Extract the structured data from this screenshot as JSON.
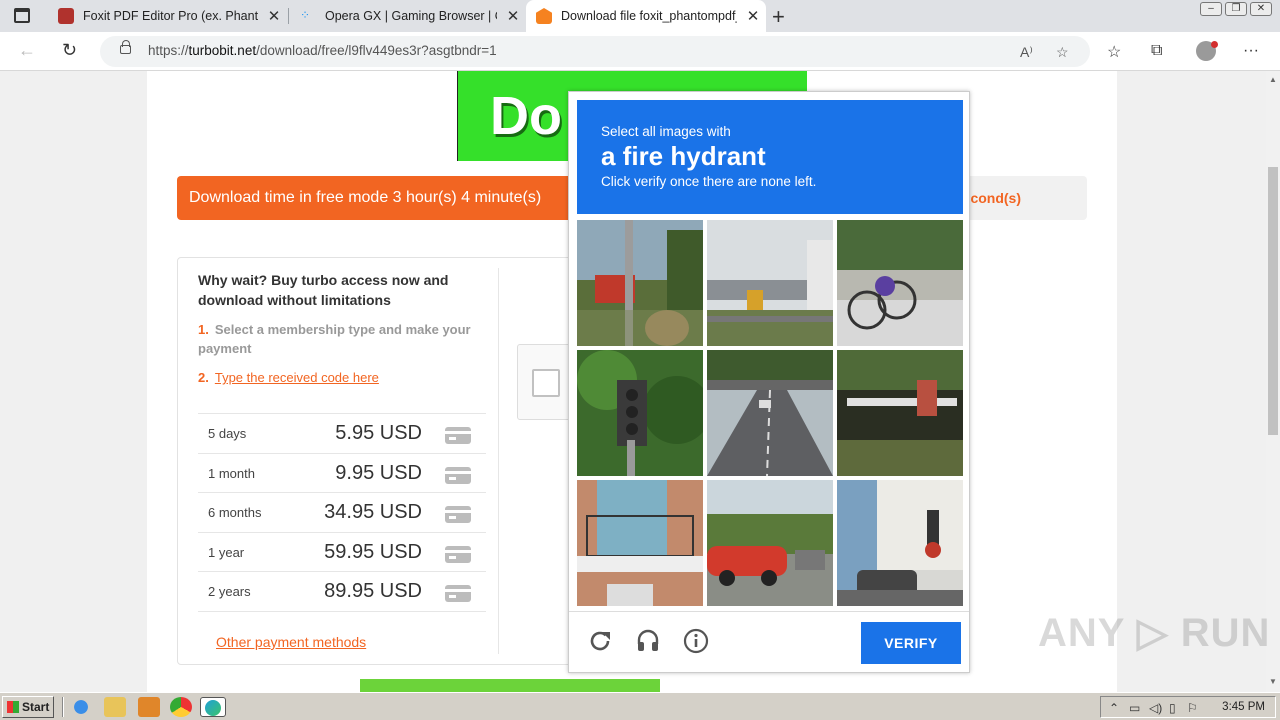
{
  "browser": {
    "tabs": [
      {
        "title": "Foxit PDF Editor Pro (ex. Phantom",
        "favicon_color": "#b0322d",
        "active": false
      },
      {
        "title": "Opera GX | Gaming Browser | Op",
        "favicon_color": "#2196f3",
        "active": false
      },
      {
        "title": "Download file foxit_phantompdf_",
        "favicon_color": "#f58220",
        "active": true
      }
    ],
    "new_tab_label": "+",
    "url_prefix": "https://",
    "url_domain": "turbobit.net",
    "url_path": "/download/free/l9flv449es3r?asgtbndr=1"
  },
  "page": {
    "banner_text": "Do",
    "timer_text": "Download time in free mode 3 hour(s) 4 minute(s)",
    "timer_right": "cond(s)",
    "turbo": {
      "heading": "Why wait? Buy turbo access now and download without limitations",
      "step1_num": "1.",
      "step1": "Select a membership type and make your payment",
      "step2_num": "2.",
      "step2": "Type the received code here",
      "plans": [
        {
          "period": "5 days",
          "price": "5.95 USD"
        },
        {
          "period": "1 month",
          "price": "9.95 USD"
        },
        {
          "period": "6 months",
          "price": "34.95 USD"
        },
        {
          "period": "1 year",
          "price": "59.95 USD"
        },
        {
          "period": "2 years",
          "price": "89.95 USD"
        }
      ],
      "other_payment": "Other payment methods"
    }
  },
  "captcha": {
    "instruction_line1": "Select all images with",
    "target": "a fire hydrant",
    "instruction_line3": "Click verify once there are none left.",
    "verify_label": "VERIFY",
    "header_color": "#1a73e8",
    "tiles": [
      {
        "name": "street-traffic-light-tile"
      },
      {
        "name": "building-bridge-tile"
      },
      {
        "name": "bicycles-tile"
      },
      {
        "name": "traffic-light-tile"
      },
      {
        "name": "highway-tile"
      },
      {
        "name": "park-bench-tile"
      },
      {
        "name": "balcony-tile"
      },
      {
        "name": "red-car-tile"
      },
      {
        "name": "city-street-tile"
      }
    ]
  },
  "watermark": "ANY ▷ RUN",
  "taskbar": {
    "start_label": "Start",
    "clock": "3:45 PM"
  }
}
